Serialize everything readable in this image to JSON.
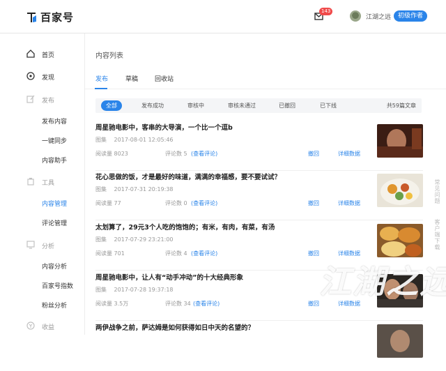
{
  "header": {
    "logo_text": "百家号",
    "notification_count": "143",
    "username": "江湖之远",
    "level_badge": "初级作者"
  },
  "sidebar": {
    "items": [
      {
        "label": "首页",
        "icon": "home-icon"
      },
      {
        "label": "发现",
        "icon": "compass-icon"
      },
      {
        "label": "发布",
        "icon": "edit-icon"
      },
      {
        "label": "发布内容"
      },
      {
        "label": "一键同步"
      },
      {
        "label": "内容助手"
      },
      {
        "label": "工具",
        "icon": "tool-icon"
      },
      {
        "label": "内容管理"
      },
      {
        "label": "评论管理"
      },
      {
        "label": "分析",
        "icon": "chart-icon"
      },
      {
        "label": "内容分析"
      },
      {
        "label": "百家号指数"
      },
      {
        "label": "粉丝分析"
      },
      {
        "label": "收益",
        "icon": "revenue-icon"
      }
    ]
  },
  "main": {
    "title": "内容列表",
    "tabs": [
      "发布",
      "草稿",
      "回收站"
    ],
    "filters": [
      "全部",
      "发布成功",
      "审核中",
      "审核未通过",
      "已撤回",
      "已下线"
    ],
    "total": "共59篇文章",
    "articles": [
      {
        "title": "周星驰电影中，客串的大导演，一个比一个逗b",
        "type": "图集",
        "date": "2017-08-01 12:05:46",
        "reads": "阅读量 8023",
        "comments": "评论数 5",
        "view_comments": "(查看评论)",
        "withdraw": "撤回",
        "details": "详细数据"
      },
      {
        "title": "花心思做的饭，才是最好的味道，满满的幸福感，要不要试试？",
        "type": "图集",
        "date": "2017-07-31 20:19:38",
        "reads": "阅读量 77",
        "comments": "评论数 0",
        "view_comments": "(查看评论)",
        "withdraw": "撤回",
        "details": "详细数据"
      },
      {
        "title": "太划算了，29元3个人吃的饱饱的；有米，有肉，有菜，有汤",
        "type": "图集",
        "date": "2017-07-29 23:21:00",
        "reads": "阅读量 701",
        "comments": "评论数 4",
        "view_comments": "(查看评论)",
        "withdraw": "撤回",
        "details": "详细数据"
      },
      {
        "title": "周星驰电影中，让人有“动手冲动”的十大经典形象",
        "type": "图集",
        "date": "2017-07-28 19:37:18",
        "reads": "阅读量 3.5万",
        "comments": "评论数 34",
        "view_comments": "(查看评论)",
        "withdraw": "撤回",
        "details": "详细数据"
      },
      {
        "title": "两伊战争之前，萨达姆是如何获得如日中天的名望的？",
        "type": "",
        "date": "",
        "reads": "",
        "comments": "",
        "view_comments": "",
        "withdraw": "",
        "details": ""
      }
    ]
  },
  "float_panel": {
    "faq": "常见问题",
    "feedback": "客户端下载"
  },
  "watermark": "江湖之远",
  "colors": {
    "accent": "#2a84e9",
    "badge": "#f04a4a"
  }
}
